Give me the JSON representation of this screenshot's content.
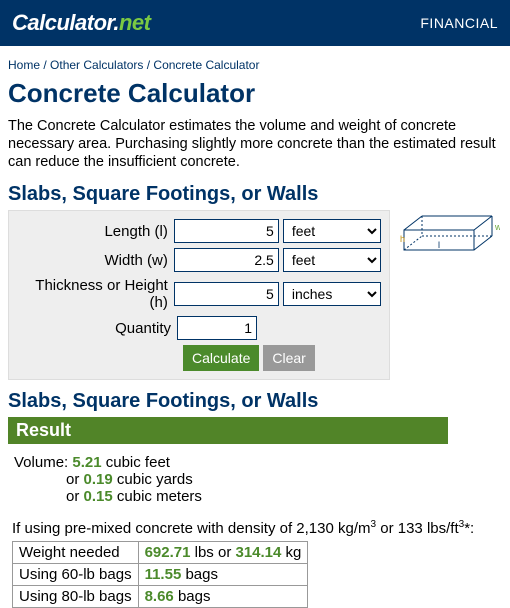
{
  "topbar": {
    "logo_left": "Calculator.",
    "logo_right": "net",
    "nav": "FINANCIAL"
  },
  "breadcrumb": {
    "home": "Home",
    "sep": " / ",
    "other": "Other Calculators",
    "current": "Concrete Calculator"
  },
  "h1": "Concrete Calculator",
  "intro": "The Concrete Calculator estimates the volume and weight of concrete necessary area. Purchasing slightly more concrete than the estimated result can reduce the insufficient concrete.",
  "section1": "Slabs, Square Footings, or Walls",
  "form": {
    "length_label": "Length (l)",
    "length_value": "5",
    "length_unit": "feet",
    "width_label": "Width (w)",
    "width_value": "2.5",
    "width_unit": "feet",
    "height_label": "Thickness or Height (h)",
    "height_value": "5",
    "height_unit": "inches",
    "quantity_label": "Quantity",
    "quantity_value": "1",
    "calc_btn": "Calculate",
    "clear_btn": "Clear"
  },
  "result": {
    "section": "Slabs, Square Footings, or Walls",
    "bar": "Result",
    "vol_label": "Volume: ",
    "ft3": "5.21",
    "ft3_unit": " cubic feet",
    "or1": "or ",
    "yd3": "0.19",
    "yd3_unit": " cubic yards",
    "or2": "or ",
    "m3": "0.15",
    "m3_unit": " cubic meters",
    "density_pre": "If using pre-mixed concrete with density of 2,130 kg/m",
    "density_mid": " or 133 lbs/ft",
    "density_suf": "*:",
    "wt_label": "Weight needed",
    "wt_lbs": "692.71",
    "wt_sep": " lbs or ",
    "wt_kg": "314.14",
    "wt_kg_unit": " kg",
    "b60_label": "Using 60-lb bags",
    "b60_val": "11.55",
    "bags_unit": " bags",
    "b80_label": "Using 80-lb bags",
    "b80_val": "8.66"
  }
}
